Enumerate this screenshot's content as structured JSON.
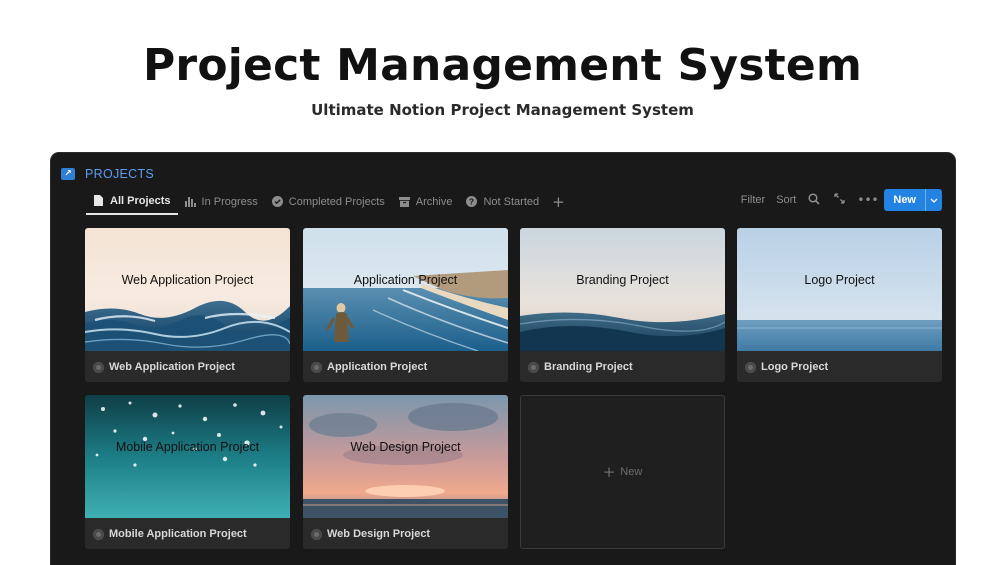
{
  "hero": {
    "title": "Project Management System",
    "subtitle": "Ultimate Notion Project Management System"
  },
  "database": {
    "icon": "arrow-square-icon",
    "title": "PROJECTS",
    "accent_color": "#2383e2"
  },
  "tabs": [
    {
      "label": "All Projects",
      "icon": "page-icon",
      "active": true
    },
    {
      "label": "In Progress",
      "icon": "bar-chart-icon",
      "active": false
    },
    {
      "label": "Completed Projects",
      "icon": "check-circle-icon",
      "active": false
    },
    {
      "label": "Archive",
      "icon": "archive-box-icon",
      "active": false
    },
    {
      "label": "Not Started",
      "icon": "question-circle-icon",
      "active": false
    }
  ],
  "toolbar": {
    "filter_label": "Filter",
    "sort_label": "Sort",
    "search_icon": "search-icon",
    "expand_icon": "expand-arrows-icon",
    "more_icon": "ellipsis-icon",
    "new_label": "New"
  },
  "cards": [
    {
      "title": "Web Application Project",
      "cover_text": "Web Application Project",
      "cover": "ocean-wave"
    },
    {
      "title": "Application Project",
      "cover_text": "Application Project",
      "cover": "coastline-person"
    },
    {
      "title": "Branding Project",
      "cover_text": "Branding Project",
      "cover": "calm-wave"
    },
    {
      "title": "Logo Project",
      "cover_text": "Logo Project",
      "cover": "sky-horizon"
    },
    {
      "title": "Mobile Application Project",
      "cover_text": "Mobile Application Project",
      "cover": "underwater-sparkle"
    },
    {
      "title": "Web Design Project",
      "cover_text": "Web Design Project",
      "cover": "sunset-clouds"
    }
  ],
  "new_card": {
    "label": "New"
  }
}
